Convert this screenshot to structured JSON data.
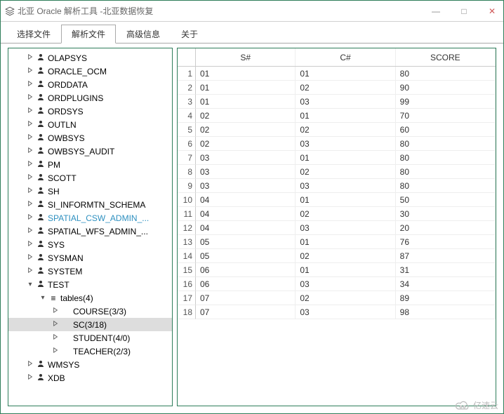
{
  "window": {
    "title": "北亚 Oracle 解析工具  -北亚数据恢复",
    "btn_min": "—",
    "btn_max": "□",
    "btn_close": "✕"
  },
  "tabs": [
    {
      "label": "选择文件",
      "active": false
    },
    {
      "label": "解析文件",
      "active": true
    },
    {
      "label": "高级信息",
      "active": false
    },
    {
      "label": "关于",
      "active": false
    }
  ],
  "tree": [
    {
      "label": "OLAPSYS",
      "depth": 1,
      "icon": "user",
      "expand": "r"
    },
    {
      "label": "ORACLE_OCM",
      "depth": 1,
      "icon": "user",
      "expand": "r"
    },
    {
      "label": "ORDDATA",
      "depth": 1,
      "icon": "user",
      "expand": "r"
    },
    {
      "label": "ORDPLUGINS",
      "depth": 1,
      "icon": "user",
      "expand": "r"
    },
    {
      "label": "ORDSYS",
      "depth": 1,
      "icon": "user",
      "expand": "r"
    },
    {
      "label": "OUTLN",
      "depth": 1,
      "icon": "user",
      "expand": "r"
    },
    {
      "label": "OWBSYS",
      "depth": 1,
      "icon": "user",
      "expand": "r"
    },
    {
      "label": "OWBSYS_AUDIT",
      "depth": 1,
      "icon": "user",
      "expand": "r"
    },
    {
      "label": "PM",
      "depth": 1,
      "icon": "user",
      "expand": "r"
    },
    {
      "label": "SCOTT",
      "depth": 1,
      "icon": "user",
      "expand": "r"
    },
    {
      "label": "SH",
      "depth": 1,
      "icon": "user",
      "expand": "r"
    },
    {
      "label": "SI_INFORMTN_SCHEMA",
      "depth": 1,
      "icon": "user",
      "expand": "r"
    },
    {
      "label": "SPATIAL_CSW_ADMIN_...",
      "depth": 1,
      "icon": "user",
      "expand": "r",
      "hl": true
    },
    {
      "label": "SPATIAL_WFS_ADMIN_...",
      "depth": 1,
      "icon": "user",
      "expand": "r"
    },
    {
      "label": "SYS",
      "depth": 1,
      "icon": "user",
      "expand": "r"
    },
    {
      "label": "SYSMAN",
      "depth": 1,
      "icon": "user",
      "expand": "r"
    },
    {
      "label": "SYSTEM",
      "depth": 1,
      "icon": "user",
      "expand": "r"
    },
    {
      "label": "TEST",
      "depth": 1,
      "icon": "user",
      "expand": "d"
    },
    {
      "label": "tables(4)",
      "depth": 2,
      "icon": "list",
      "expand": "d"
    },
    {
      "label": "COURSE(3/3)",
      "depth": 3,
      "icon": "",
      "expand": "r"
    },
    {
      "label": "SC(3/18)",
      "depth": 3,
      "icon": "",
      "expand": "r",
      "sel": true
    },
    {
      "label": "STUDENT(4/0)",
      "depth": 3,
      "icon": "",
      "expand": "r"
    },
    {
      "label": "TEACHER(2/3)",
      "depth": 3,
      "icon": "",
      "expand": "r"
    },
    {
      "label": "WMSYS",
      "depth": 1,
      "icon": "user",
      "expand": "r"
    },
    {
      "label": "XDB",
      "depth": 1,
      "icon": "user",
      "expand": "r"
    }
  ],
  "grid": {
    "columns": [
      "S#",
      "C#",
      "SCORE"
    ],
    "rows": [
      [
        "01",
        "01",
        "80"
      ],
      [
        "01",
        "02",
        "90"
      ],
      [
        "01",
        "03",
        "99"
      ],
      [
        "02",
        "01",
        "70"
      ],
      [
        "02",
        "02",
        "60"
      ],
      [
        "02",
        "03",
        "80"
      ],
      [
        "03",
        "01",
        "80"
      ],
      [
        "03",
        "02",
        "80"
      ],
      [
        "03",
        "03",
        "80"
      ],
      [
        "04",
        "01",
        "50"
      ],
      [
        "04",
        "02",
        "30"
      ],
      [
        "04",
        "03",
        "20"
      ],
      [
        "05",
        "01",
        "76"
      ],
      [
        "05",
        "02",
        "87"
      ],
      [
        "06",
        "01",
        "31"
      ],
      [
        "06",
        "03",
        "34"
      ],
      [
        "07",
        "02",
        "89"
      ],
      [
        "07",
        "03",
        "98"
      ]
    ]
  },
  "watermark": "亿速云"
}
